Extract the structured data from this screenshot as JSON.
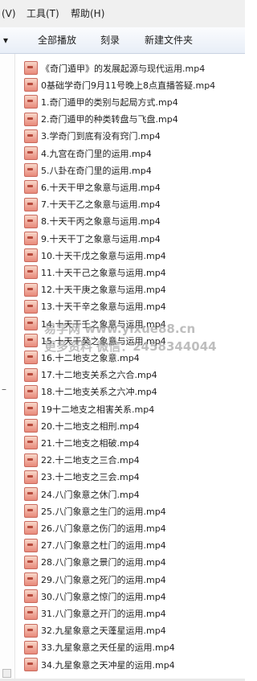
{
  "menu": {
    "view": "(V)",
    "tools": "工具(T)",
    "help": "帮助(H)"
  },
  "toolbar": {
    "dropdown": "▾",
    "play_all": "全部播放",
    "burn": "刻录",
    "new_folder": "新建文件夹"
  },
  "files": [
    "《奇门遁甲》的发展起源与现代运用.mp4",
    "0基础学奇门9月11号晚上8点直播答疑.mp4",
    "1.奇门遁甲的类别与起局方式.mp4",
    "2.奇门遁甲的种类转盘与飞盘.mp4",
    "3.学奇门到底有没有窍门.mp4",
    "4.九宫在奇门里的运用.mp4",
    "5.八卦在奇门里的运用.mp4",
    "6.十天干甲之象意与运用.mp4",
    "7.十天干乙之象意与运用.mp4",
    "8.十天干丙之象意与运用.mp4",
    "9.十天干丁之象意与运用.mp4",
    "10.十天干戊之象意与运用.mp4",
    "11.十天干己之象意与运用.mp4",
    "12.十天干庚之象意与运用.mp4",
    "13.十天干辛之象意与运用.mp4",
    "14.十天干壬之象意与运用.mp4",
    "15.十天干癸之象意与运用.mp4",
    "16.十二地支之象意.mp4",
    "17.十二地支关系之六合.mp4",
    "18.十二地支关系之六冲.mp4",
    "19十二地支之相害关系.mp4",
    "20.十二地支之相刑.mp4",
    "21.十二地支之相破.mp4",
    "22.十二地支之三合.mp4",
    "23.十二地支之三会.mp4",
    "24.八门象意之休门.mp4",
    "25.八门象意之生门的运用.mp4",
    "26.八门象意之伤门的运用.mp4",
    "27.八门象意之杜门的运用.mp4",
    "28.八门象意之景门的运用.mp4",
    "29.八门象意之死门的运用.mp4",
    "30.八门象意之惊门的运用.mp4",
    "31.八门象意之开门的运用.mp4",
    "32.九星象意之天蓬星运用.mp4",
    "33.九星象意之天任星的运用.mp4",
    "34.九星象意之天冲星的运用.mp4"
  ],
  "watermark": {
    "line1": "易学网 www.yixue88.cn",
    "line2": "更多资料 微信：2458344044"
  },
  "colors": {
    "menubar": "#f0f0f0",
    "toolbar": "#e8eef7",
    "file_icon": "#e8897a"
  }
}
